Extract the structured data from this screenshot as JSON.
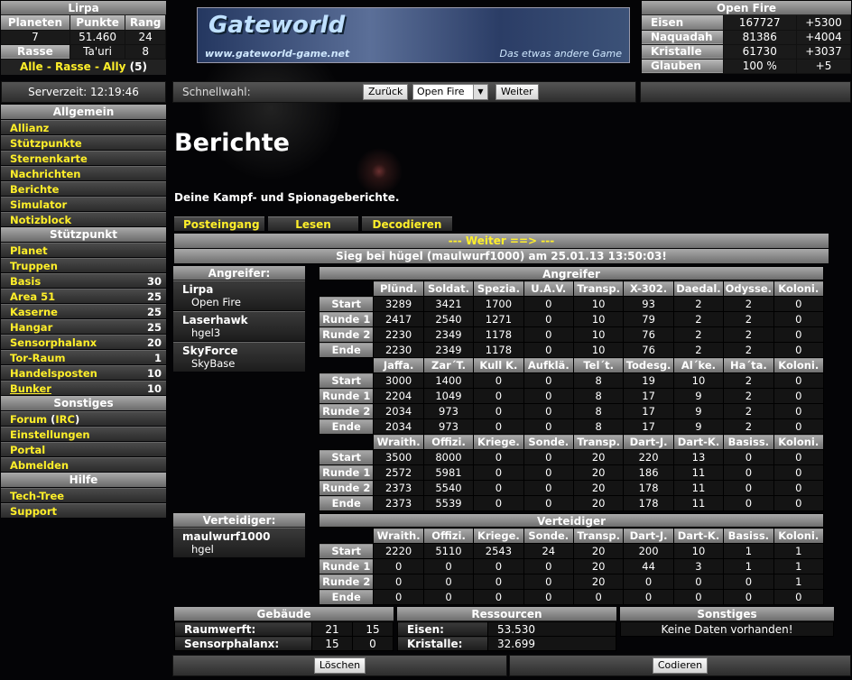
{
  "player": {
    "name": "Lirpa",
    "headers": [
      "Planeten",
      "Punkte",
      "Rang"
    ],
    "values": [
      "7",
      "51.460",
      "24"
    ],
    "race_label": "Rasse",
    "race": "Ta'uri",
    "race_val": "8"
  },
  "nav_links": {
    "all": "Alle",
    "race": "Rasse",
    "ally": "Ally",
    "count": "(5)",
    "sep1": " - ",
    "sep2": " - "
  },
  "server_time": "Serverzeit: 12:19:46",
  "logo": {
    "title": "Gateworld",
    "url": "www.gateworld-game.net",
    "slogan": "Das etwas andere Game"
  },
  "planet": {
    "title": "Open Fire",
    "rows": [
      {
        "label": "Eisen",
        "amount": "167727",
        "rate": "+5300"
      },
      {
        "label": "Naquadah",
        "amount": "81386",
        "rate": "+4004"
      },
      {
        "label": "Kristalle",
        "amount": "61730",
        "rate": "+3037"
      },
      {
        "label": "Glauben",
        "amount": "100 %",
        "rate": "+5"
      }
    ]
  },
  "quick": {
    "label": "Schnellwahl:",
    "back": "Zurück",
    "selected": "Open Fire",
    "forward": "Weiter"
  },
  "menu": {
    "allgemein_title": "Allgemein",
    "allgemein": [
      "Allianz",
      "Stützpunkte",
      "Sternenkarte",
      "Nachrichten",
      "Berichte",
      "Simulator",
      "Notizblock"
    ],
    "stuetzpunkt_title": "Stützpunkt",
    "stuetzpunkt": [
      {
        "label": "Planet",
        "n": ""
      },
      {
        "label": "Truppen",
        "n": ""
      },
      {
        "label": "Basis",
        "n": "30"
      },
      {
        "label": "Area 51",
        "n": "25"
      },
      {
        "label": "Kaserne",
        "n": "25"
      },
      {
        "label": "Hangar",
        "n": "25"
      },
      {
        "label": "Sensorphalanx",
        "n": "20"
      },
      {
        "label": "Tor-Raum",
        "n": "1"
      },
      {
        "label": "Handelsposten",
        "n": "10"
      },
      {
        "label": "Bunker",
        "n": "10"
      }
    ],
    "sonstiges_title": "Sonstiges",
    "forum": "Forum",
    "irc": "IRC",
    "forum_open": " (",
    "forum_close": ")",
    "sonstiges": [
      "Einstellungen",
      "Portal",
      "Abmelden"
    ],
    "hilfe_title": "Hilfe",
    "hilfe": [
      "Tech-Tree",
      "Support"
    ]
  },
  "page": {
    "title": "Berichte",
    "subtitle": "Deine Kampf- und Spionageberichte."
  },
  "tabs": [
    "Posteingang",
    "Lesen",
    "Decodieren"
  ],
  "report": {
    "next": "Weiter ==>",
    "next_prefix": "--- ",
    "title": "Sieg bei hügel (maulwurf1000) am 25.01.13 13:50:03!",
    "attackers_title": "Angreifer:",
    "attackers": [
      {
        "name": "Lirpa",
        "planet": "Open Fire"
      },
      {
        "name": "Laserhawk",
        "planet": "hgel3"
      },
      {
        "name": "SkyForce",
        "planet": "SkyBase"
      }
    ],
    "defenders_title": "Verteidiger:",
    "defenders": [
      {
        "name": "maulwurf1000",
        "planet": "hgel"
      }
    ],
    "att_table_title": "Angreifer",
    "def_table_title": "Verteidiger",
    "rows": [
      "Start",
      "Runde 1",
      "Runde 2",
      "Ende"
    ],
    "att_blocks": [
      {
        "cols": [
          "Plünd.",
          "Soldat.",
          "Spezia.",
          "U.A.V.",
          "Transp.",
          "X-302.",
          "Daedal.",
          "Odysse.",
          "Koloni."
        ],
        "data": [
          [
            "3289",
            "3421",
            "1700",
            "0",
            "10",
            "93",
            "2",
            "2",
            "0"
          ],
          [
            "2417",
            "2540",
            "1271",
            "0",
            "10",
            "79",
            "2",
            "2",
            "0"
          ],
          [
            "2230",
            "2349",
            "1178",
            "0",
            "10",
            "76",
            "2",
            "2",
            "0"
          ],
          [
            "2230",
            "2349",
            "1178",
            "0",
            "10",
            "76",
            "2",
            "2",
            "0"
          ]
        ]
      },
      {
        "cols": [
          "Jaffa.",
          "Zar´T.",
          "Kull K.",
          "Aufklä.",
          "Tel´t.",
          "Todesg.",
          "Al´ke.",
          "Ha´ta.",
          "Koloni."
        ],
        "data": [
          [
            "3000",
            "1400",
            "0",
            "0",
            "8",
            "19",
            "10",
            "2",
            "0"
          ],
          [
            "2204",
            "1049",
            "0",
            "0",
            "8",
            "17",
            "9",
            "2",
            "0"
          ],
          [
            "2034",
            "973",
            "0",
            "0",
            "8",
            "17",
            "9",
            "2",
            "0"
          ],
          [
            "2034",
            "973",
            "0",
            "0",
            "8",
            "17",
            "9",
            "2",
            "0"
          ]
        ]
      },
      {
        "cols": [
          "Wraith.",
          "Offizi.",
          "Kriege.",
          "Sonde.",
          "Transp.",
          "Dart-J.",
          "Dart-K.",
          "Basiss.",
          "Koloni."
        ],
        "data": [
          [
            "3500",
            "8000",
            "0",
            "0",
            "20",
            "220",
            "13",
            "0",
            "0"
          ],
          [
            "2572",
            "5981",
            "0",
            "0",
            "20",
            "186",
            "11",
            "0",
            "0"
          ],
          [
            "2373",
            "5540",
            "0",
            "0",
            "20",
            "178",
            "11",
            "0",
            "0"
          ],
          [
            "2373",
            "5539",
            "0",
            "0",
            "20",
            "178",
            "11",
            "0",
            "0"
          ]
        ]
      }
    ],
    "def_block": {
      "cols": [
        "Wraith.",
        "Offizi.",
        "Kriege.",
        "Sonde.",
        "Transp.",
        "Dart-J.",
        "Dart-K.",
        "Basiss.",
        "Koloni."
      ],
      "data": [
        [
          "2220",
          "5110",
          "2543",
          "24",
          "20",
          "200",
          "10",
          "1",
          "1"
        ],
        [
          "0",
          "0",
          "0",
          "0",
          "20",
          "44",
          "3",
          "1",
          "1"
        ],
        [
          "0",
          "0",
          "0",
          "0",
          "20",
          "0",
          "0",
          "0",
          "1"
        ],
        [
          "0",
          "0",
          "0",
          "0",
          "0",
          "0",
          "0",
          "0",
          "0"
        ]
      ]
    },
    "buildings_title": "Gebäude",
    "buildings": [
      {
        "label": "Raumwerft:",
        "a": "21",
        "b": "15"
      },
      {
        "label": "Sensorphalanx:",
        "a": "15",
        "b": "0"
      }
    ],
    "resources_title": "Ressourcen",
    "resources": [
      {
        "label": "Eisen:",
        "v": "53.530"
      },
      {
        "label": "Kristalle:",
        "v": "32.699"
      }
    ],
    "misc_title": "Sonstiges",
    "misc": "Keine Daten vorhanden!",
    "delete": "Löschen",
    "decode": "Codieren"
  }
}
